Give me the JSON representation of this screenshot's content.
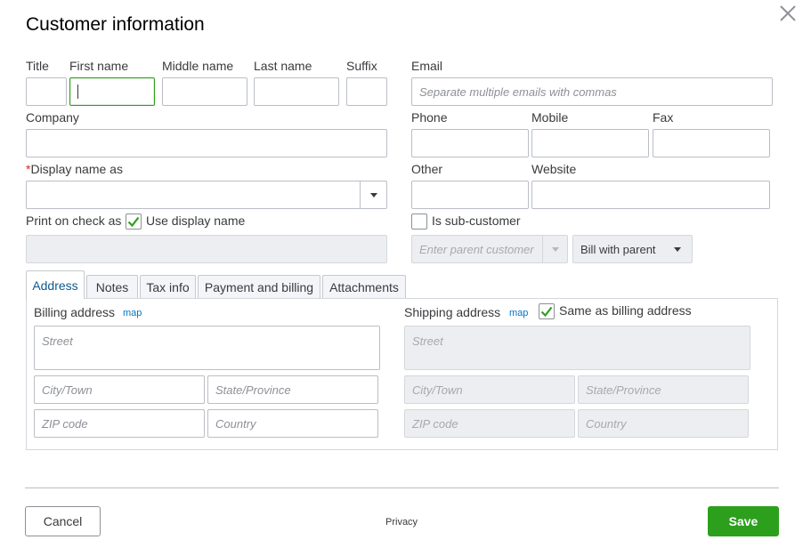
{
  "dialog": {
    "title": "Customer information"
  },
  "name_fields": {
    "title_label": "Title",
    "first_label": "First name",
    "middle_label": "Middle name",
    "last_label": "Last name",
    "suffix_label": "Suffix"
  },
  "email": {
    "label": "Email",
    "placeholder": "Separate multiple emails with commas"
  },
  "company": {
    "label": "Company"
  },
  "phones": {
    "phone_label": "Phone",
    "mobile_label": "Mobile",
    "fax_label": "Fax",
    "other_label": "Other",
    "website_label": "Website"
  },
  "display_name": {
    "required_mark": "*",
    "label": "Display name as"
  },
  "print_on_check": {
    "label": "Print on check as",
    "use_display_label": "Use display name",
    "use_display_checked": true
  },
  "sub_customer": {
    "label": "Is sub-customer",
    "checked": false,
    "parent_placeholder": "Enter parent customer",
    "bill_option": "Bill with parent"
  },
  "tabs": [
    {
      "label": "Address",
      "active": true
    },
    {
      "label": "Notes",
      "active": false
    },
    {
      "label": "Tax info",
      "active": false
    },
    {
      "label": "Payment and billing",
      "active": false
    },
    {
      "label": "Attachments",
      "active": false
    }
  ],
  "billing": {
    "label": "Billing address",
    "map_link": "map",
    "street_placeholder": "Street",
    "city_placeholder": "City/Town",
    "state_placeholder": "State/Province",
    "zip_placeholder": "ZIP code",
    "country_placeholder": "Country"
  },
  "shipping": {
    "label": "Shipping address",
    "map_link": "map",
    "same_label": "Same as billing address",
    "same_checked": true,
    "street_placeholder": "Street",
    "city_placeholder": "City/Town",
    "state_placeholder": "State/Province",
    "zip_placeholder": "ZIP code",
    "country_placeholder": "Country"
  },
  "footer": {
    "cancel_label": "Cancel",
    "privacy_label": "Privacy",
    "save_label": "Save"
  },
  "colors": {
    "accent_green": "#2ca01c",
    "link_blue": "#0077c5",
    "required_red": "#d52b1e"
  }
}
